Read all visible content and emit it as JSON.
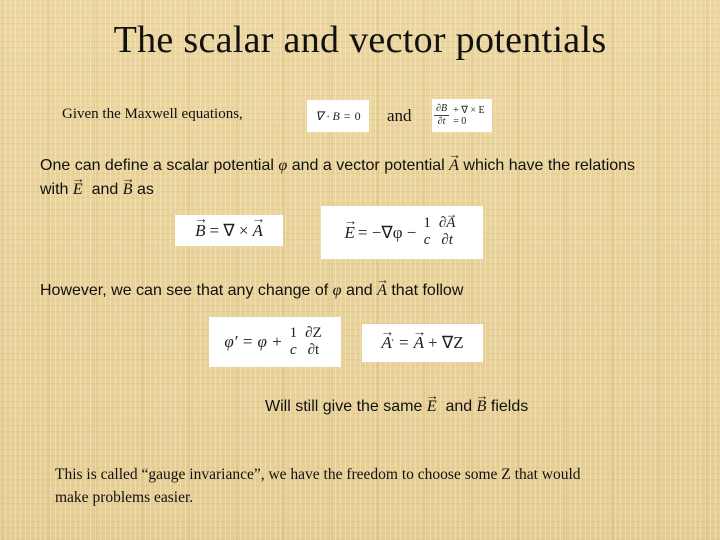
{
  "title": "The scalar and vector potentials",
  "given": {
    "label": "Given the Maxwell equations,",
    "and": "and",
    "eq1": {
      "lhs": "∇ · B",
      "op": "=",
      "rhs": "0"
    },
    "eq2": {
      "num": "∂B",
      "den": "∂t",
      "rest": "+ ∇ × E = 0"
    }
  },
  "intro": {
    "line1_pre": "One can define a scalar potential",
    "phi": "φ",
    "line1_mid": "and a vector potential",
    "A": "A",
    "line1_post": "which have the relations",
    "line2_pre": "with",
    "E": "E",
    "line2_and": "and",
    "B": "B",
    "line2_post": "as"
  },
  "relations": {
    "B_def": {
      "lhs": "B",
      "rhs_pre": "= ∇ ×",
      "rhs_vec": "A"
    },
    "E_def": {
      "lhs": "E",
      "rhs": "= −∇φ −",
      "frac1_num": "1",
      "frac1_den": "c",
      "frac2_num": "∂",
      "frac2_vec": "A",
      "frac2_den": "∂t"
    }
  },
  "however": {
    "pre": "However, we can see that any change of",
    "phi": "φ",
    "and": "and",
    "A": "A",
    "post": "that follow"
  },
  "gauge": {
    "phi_eq": {
      "lhs": "φ′ = φ +",
      "frac1_num": "1",
      "frac1_den": "c",
      "frac2_num": "∂Z",
      "frac2_den": "∂t"
    },
    "A_eq": {
      "lhs": "A",
      "prime": "′",
      "rhs_pre": "=",
      "rhs_vec": "A",
      "rhs_post": "+ ∇Z"
    }
  },
  "still": {
    "pre": "Will still give the same",
    "E": "E",
    "and": "and",
    "B": "B",
    "post": "fields"
  },
  "conclusion": {
    "line1": "This is called “gauge invariance”, we have the freedom to choose some Z that would",
    "line2": "make problems easier."
  }
}
